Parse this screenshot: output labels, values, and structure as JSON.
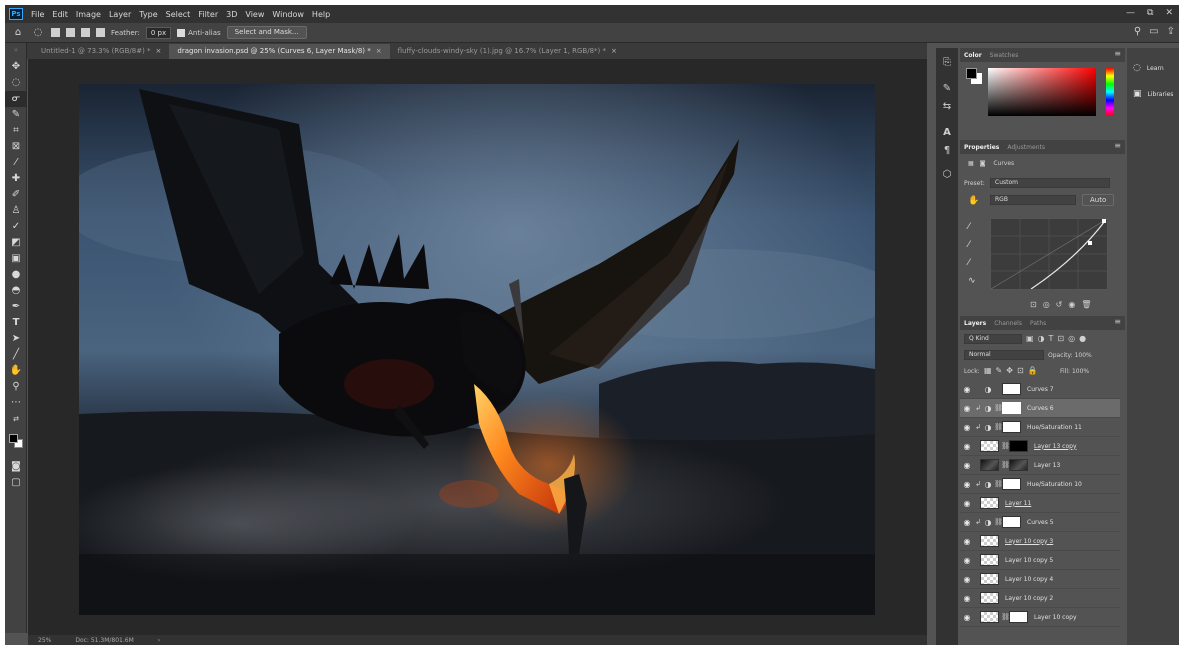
{
  "menubar": {
    "logo": "Ps",
    "items": [
      "File",
      "Edit",
      "Image",
      "Layer",
      "Type",
      "Select",
      "Filter",
      "3D",
      "View",
      "Window",
      "Help"
    ],
    "window_controls": [
      "—",
      "⧉",
      "✕"
    ]
  },
  "options_bar": {
    "feather_label": "Feather:",
    "feather_value": "0 px",
    "antialias_label": "Anti-alias",
    "select_mask_label": "Select and Mask..."
  },
  "tabs": [
    {
      "label": "Untitled-1 @ 73.3% (RGB/8#) *",
      "active": false
    },
    {
      "label": "dragon invasion.psd @ 25% (Curves 6, Layer Mask/8) *",
      "active": true
    },
    {
      "label": "fluffy-clouds-windy-sky (1).jpg @ 16.7% (Layer 1, RGB/8*) *",
      "active": false
    }
  ],
  "status": {
    "zoom": "25%",
    "doc": "Doc: 51.3M/801.6M"
  },
  "color_panel": {
    "tabs": [
      "Color",
      "Swatches"
    ]
  },
  "properties_panel": {
    "tabs": [
      "Properties",
      "Adjustments"
    ],
    "title": "Curves",
    "preset_label": "Preset:",
    "preset_value": "Custom",
    "channel_value": "RGB",
    "auto_label": "Auto"
  },
  "layers_panel": {
    "tabs": [
      "Layers",
      "Channels",
      "Paths"
    ],
    "kind_label": "Q Kind",
    "blend_mode": "Normal",
    "opacity_label": "Opacity:",
    "opacity_value": "100%",
    "lock_label": "Lock:",
    "fill_label": "Fill:",
    "fill_value": "100%",
    "layers": [
      {
        "name": "Curves 7",
        "type": "adjustment",
        "selected": false
      },
      {
        "name": "Curves 6",
        "type": "adjustment",
        "selected": true
      },
      {
        "name": "Hue/Saturation 11",
        "type": "adjustment",
        "selected": false
      },
      {
        "name": "Layer 13 copy",
        "type": "masked",
        "selected": false
      },
      {
        "name": "Layer 13",
        "type": "image",
        "selected": false
      },
      {
        "name": "Hue/Saturation 10",
        "type": "adjustment",
        "selected": false
      },
      {
        "name": "Layer 11",
        "type": "pixel",
        "selected": false
      },
      {
        "name": "Curves 5",
        "type": "adjustment",
        "selected": false
      },
      {
        "name": "Layer 10 copy 3",
        "type": "pixel",
        "selected": false
      },
      {
        "name": "Layer 10 copy 5",
        "type": "pixel",
        "selected": false
      },
      {
        "name": "Layer 10 copy 4",
        "type": "pixel",
        "selected": false
      },
      {
        "name": "Layer 10 copy 2",
        "type": "pixel",
        "selected": false
      },
      {
        "name": "Layer 10 copy",
        "type": "pixel-mask",
        "selected": false
      }
    ]
  },
  "learn_panel": {
    "learn_label": "Learn",
    "libraries_label": "Libraries"
  }
}
